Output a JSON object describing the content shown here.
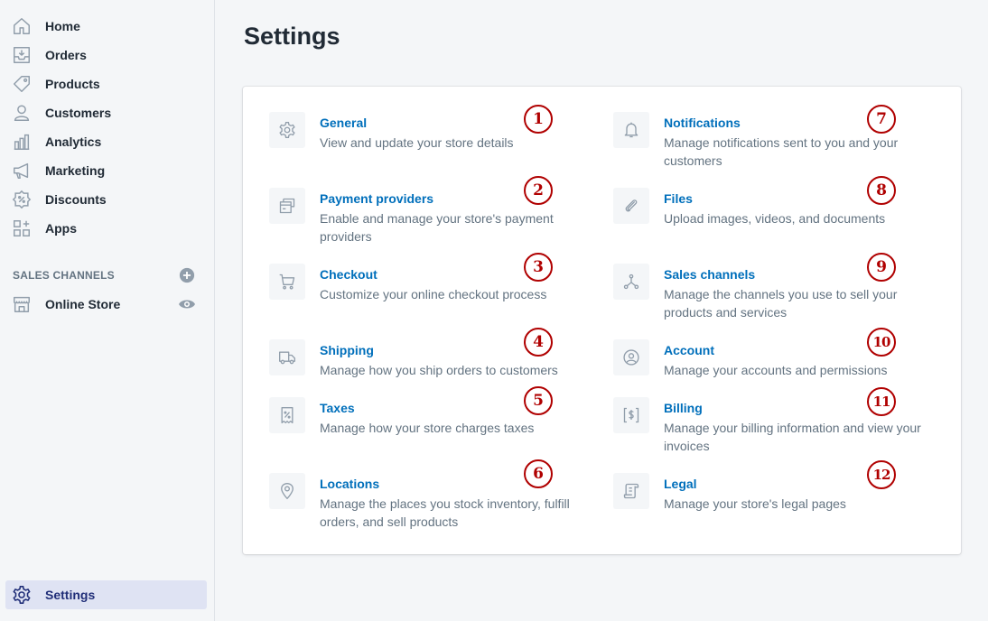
{
  "sidebar": {
    "items": [
      {
        "label": "Home",
        "icon": "home-icon"
      },
      {
        "label": "Orders",
        "icon": "orders-icon"
      },
      {
        "label": "Products",
        "icon": "tag-icon"
      },
      {
        "label": "Customers",
        "icon": "person-icon"
      },
      {
        "label": "Analytics",
        "icon": "bar-chart-icon"
      },
      {
        "label": "Marketing",
        "icon": "megaphone-icon"
      },
      {
        "label": "Discounts",
        "icon": "discount-icon"
      },
      {
        "label": "Apps",
        "icon": "apps-icon"
      }
    ],
    "sales_channels": {
      "title": "SALES CHANNELS",
      "online_store": "Online Store"
    },
    "settings": "Settings"
  },
  "page": {
    "title": "Settings"
  },
  "settings_items": [
    {
      "title": "General",
      "desc": "View and update your store details",
      "badge": "1",
      "icon": "gear-icon"
    },
    {
      "title": "Payment providers",
      "desc": "Enable and manage your store's payment providers",
      "badge": "2",
      "icon": "payment-icon"
    },
    {
      "title": "Checkout",
      "desc": "Customize your online checkout process",
      "badge": "3",
      "icon": "cart-icon"
    },
    {
      "title": "Shipping",
      "desc": "Manage how you ship orders to customers",
      "badge": "4",
      "icon": "truck-icon"
    },
    {
      "title": "Taxes",
      "desc": "Manage how your store charges taxes",
      "badge": "5",
      "icon": "tax-receipt-icon"
    },
    {
      "title": "Locations",
      "desc": "Manage the places you stock inventory, fulfill orders, and sell products",
      "badge": "6",
      "icon": "location-pin-icon"
    },
    {
      "title": "Notifications",
      "desc": "Manage notifications sent to you and your customers",
      "badge": "7",
      "icon": "bell-icon"
    },
    {
      "title": "Files",
      "desc": "Upload images, videos, and documents",
      "badge": "8",
      "icon": "paperclip-icon"
    },
    {
      "title": "Sales channels",
      "desc": "Manage the channels you use to sell your products and services",
      "badge": "9",
      "icon": "channels-icon"
    },
    {
      "title": "Account",
      "desc": "Manage your accounts and permissions",
      "badge": "10",
      "icon": "account-icon"
    },
    {
      "title": "Billing",
      "desc": "Manage your billing information and view your invoices",
      "badge": "11",
      "icon": "billing-icon"
    },
    {
      "title": "Legal",
      "desc": "Manage your store's legal pages",
      "badge": "12",
      "icon": "legal-scroll-icon"
    }
  ],
  "colors": {
    "link": "#006fbb",
    "muted": "#637381",
    "badge": "#b00000",
    "active_bg": "#dfe3f3"
  }
}
